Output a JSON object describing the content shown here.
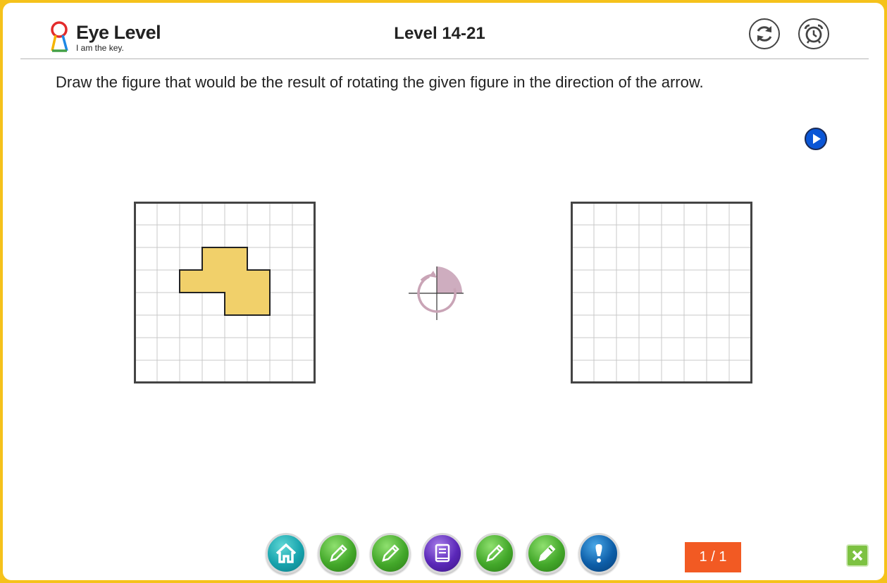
{
  "header": {
    "logo_name": "Eye Level",
    "logo_tagline": "I am the key.",
    "level_title": "Level 14-21",
    "refresh_icon": "refresh-icon",
    "alarm_icon": "alarm-clock-icon"
  },
  "question": {
    "text": "Draw the figure that would be the result of rotating the given figure in the direction of the arrow.",
    "play_icon": "play-icon"
  },
  "workspace": {
    "given_grid": {
      "rows": 8,
      "cols": 8,
      "shape_color": "#f1d06a"
    },
    "rotation": {
      "icon": "rotation-quarter-turn-icon",
      "color": "#c9a4b6"
    },
    "answer_grid": {
      "rows": 8,
      "cols": 8
    }
  },
  "toolbar": {
    "tools": [
      {
        "name": "home",
        "icon": "home-icon",
        "color": "teal"
      },
      {
        "name": "pencil-1",
        "icon": "pencil-icon",
        "color": "green"
      },
      {
        "name": "pencil-2",
        "icon": "pencil-icon",
        "color": "green"
      },
      {
        "name": "book",
        "icon": "book-icon",
        "color": "purple"
      },
      {
        "name": "pencil-3",
        "icon": "pencil-icon",
        "color": "green"
      },
      {
        "name": "pencil-4",
        "icon": "pencil-icon",
        "color": "green"
      },
      {
        "name": "hint",
        "icon": "exclamation-icon",
        "color": "blue"
      }
    ]
  },
  "pagination": {
    "label": "1 / 1"
  },
  "close_icon": "close-icon",
  "colors": {
    "frame": "#f5c21b",
    "badge": "#f25a23",
    "close": "#7dc242"
  }
}
